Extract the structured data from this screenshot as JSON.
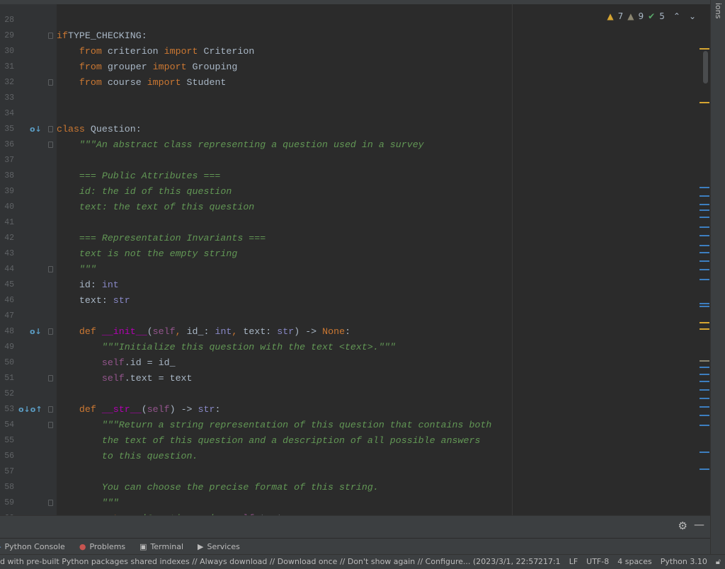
{
  "editor": {
    "lines": [
      {
        "n": "28",
        "t": []
      },
      {
        "n": "29",
        "t": [
          [
            "kw",
            "if"
          ],
          [
            "",
            "TYPE_CHECKING:"
          ]
        ],
        "fold": 1,
        "sp": [
          1
        ]
      },
      {
        "n": "30",
        "t": [
          [
            "",
            "    "
          ],
          [
            "kw",
            "from"
          ],
          [
            "",
            " criterion "
          ],
          [
            "kw",
            "import"
          ],
          [
            "",
            " Criterion"
          ]
        ]
      },
      {
        "n": "31",
        "t": [
          [
            "",
            "    "
          ],
          [
            "kw",
            "from"
          ],
          [
            "",
            " grouper "
          ],
          [
            "kw",
            "import"
          ],
          [
            "",
            " Grouping"
          ]
        ]
      },
      {
        "n": "32",
        "t": [
          [
            "",
            "    "
          ],
          [
            "kw",
            "from"
          ],
          [
            "",
            " course "
          ],
          [
            "kw",
            "import"
          ],
          [
            "",
            " Student"
          ]
        ],
        "fold": 1
      },
      {
        "n": "33",
        "t": []
      },
      {
        "n": "34",
        "t": []
      },
      {
        "n": "35",
        "t": [
          [
            "kw",
            "class"
          ],
          [
            "",
            " Question:"
          ]
        ],
        "fold": 1,
        "icons": "o↓"
      },
      {
        "n": "36",
        "t": [
          [
            "doc",
            "    \"\"\"An abstract class representing a question used in a survey"
          ]
        ],
        "fold": 1
      },
      {
        "n": "37",
        "t": []
      },
      {
        "n": "38",
        "t": [
          [
            "doc",
            "    === Public Attributes ==="
          ]
        ]
      },
      {
        "n": "39",
        "t": [
          [
            "doc",
            "    id: the id of this question"
          ]
        ]
      },
      {
        "n": "40",
        "t": [
          [
            "doc",
            "    text: the text of this question"
          ]
        ]
      },
      {
        "n": "41",
        "t": []
      },
      {
        "n": "42",
        "t": [
          [
            "doc",
            "    === Representation Invariants ==="
          ]
        ]
      },
      {
        "n": "43",
        "t": [
          [
            "doc",
            "    text is not the empty string"
          ]
        ]
      },
      {
        "n": "44",
        "t": [
          [
            "doc",
            "    \"\"\""
          ]
        ],
        "fold": 1
      },
      {
        "n": "45",
        "t": [
          [
            "",
            "    id: "
          ],
          [
            "ty",
            "int"
          ]
        ]
      },
      {
        "n": "46",
        "t": [
          [
            "",
            "    text: "
          ],
          [
            "ty",
            "str"
          ]
        ]
      },
      {
        "n": "47",
        "t": []
      },
      {
        "n": "48",
        "t": [
          [
            "",
            "    "
          ],
          [
            "kw",
            "def "
          ],
          [
            "dn",
            "__init__"
          ],
          [
            "",
            "("
          ],
          [
            "sf",
            "self"
          ],
          [
            "kw",
            ", "
          ],
          [
            "",
            "id_: "
          ],
          [
            "ty",
            "int"
          ],
          [
            "kw",
            ", "
          ],
          [
            "",
            "text: "
          ],
          [
            "ty",
            "str"
          ],
          [
            "",
            ") -> "
          ],
          [
            "kw",
            "None"
          ],
          [
            "",
            ":"
          ]
        ],
        "fold": 1,
        "icons": "o↓"
      },
      {
        "n": "49",
        "t": [
          [
            "doc",
            "        \"\"\"Initialize this question with the text <text>.\"\"\""
          ]
        ]
      },
      {
        "n": "50",
        "t": [
          [
            "",
            "        "
          ],
          [
            "sf",
            "self"
          ],
          [
            "",
            ".id = id_"
          ]
        ]
      },
      {
        "n": "51",
        "t": [
          [
            "",
            "        "
          ],
          [
            "sf",
            "self"
          ],
          [
            "",
            ".text = text"
          ]
        ],
        "fold": 1
      },
      {
        "n": "52",
        "t": []
      },
      {
        "n": "53",
        "t": [
          [
            "",
            "    "
          ],
          [
            "kw",
            "def "
          ],
          [
            "dn",
            "__str__"
          ],
          [
            "",
            "("
          ],
          [
            "sf",
            "self"
          ],
          [
            "",
            ") -> "
          ],
          [
            "ty",
            "str"
          ],
          [
            "",
            ":"
          ]
        ],
        "fold": 1,
        "icons": "o↓o↑"
      },
      {
        "n": "54",
        "t": [
          [
            "doc",
            "        \"\"\"Return a string representation of this question that contains both"
          ]
        ],
        "fold": 1
      },
      {
        "n": "55",
        "t": [
          [
            "doc",
            "        the text of this question and a description of all possible answers"
          ]
        ]
      },
      {
        "n": "56",
        "t": [
          [
            "doc",
            "        to this question."
          ]
        ]
      },
      {
        "n": "57",
        "t": []
      },
      {
        "n": "58",
        "t": [
          [
            "doc",
            "        You can choose the precise format of this string."
          ]
        ]
      },
      {
        "n": "59",
        "t": [
          [
            "doc",
            "        \"\"\""
          ]
        ],
        "fold": 1
      },
      {
        "n": "60",
        "t": [
          [
            "",
            "        "
          ],
          [
            "kw",
            "return "
          ],
          [
            "doc",
            "'Question : '"
          ],
          [
            "",
            " + "
          ],
          [
            "sf",
            "self"
          ],
          [
            "",
            ".text"
          ]
        ],
        "fold": 1
      }
    ]
  },
  "inspections": {
    "warnings": "7",
    "weak_warnings": "9",
    "typos": "5"
  },
  "right_toolbar": {
    "label": "ions"
  },
  "tool_tabs": [
    {
      "label": "Python Console",
      "icon": "python-console-icon"
    },
    {
      "label": "Problems",
      "icon": "problems-icon"
    },
    {
      "label": "Terminal",
      "icon": "terminal-icon"
    },
    {
      "label": "Services",
      "icon": "services-icon"
    }
  ],
  "status": {
    "message": "d with pre-built Python packages shared indexes // Always download // Download once // Don't show again // Configure... (2023/3/1, 22:57",
    "position": "217:1",
    "line_sep": "LF",
    "encoding": "UTF-8",
    "indent": "4 spaces",
    "interpreter": "Python 3.10"
  },
  "colors": {
    "background": "#2b2b2b",
    "keyword": "#cc7832",
    "docstring": "#629755",
    "warning": "#d6a531",
    "info_marker": "#3d7ebf"
  }
}
